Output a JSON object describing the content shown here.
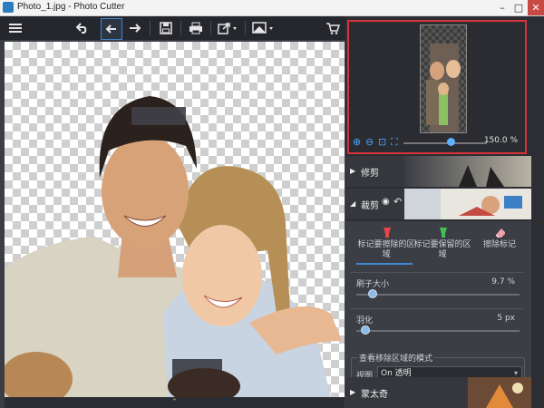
{
  "window": {
    "title": "Photo_1.jpg - Photo Cutter"
  },
  "toolbar": {
    "icons": [
      "menu-icon",
      "undo-icon",
      "redo-back-icon",
      "redo-icon",
      "save-icon",
      "print-icon",
      "export-icon",
      "background-icon",
      "cart-icon"
    ]
  },
  "navigator": {
    "zoom_value": "150.0 %"
  },
  "sections": {
    "crop": {
      "label": "修剪"
    },
    "segment": {
      "label": "裁剪"
    },
    "montage": {
      "label": "蒙太奇"
    }
  },
  "segment_panel": {
    "mark_remove": {
      "line1": "标记要擦除的区",
      "line2": "域"
    },
    "mark_keep": {
      "line1": "标记要保留的区",
      "line2": "域"
    },
    "erase_marks": {
      "label": "擦除标记"
    },
    "brush_size": {
      "label": "刷子大小",
      "value": "9.7 %",
      "level": 0.097
    },
    "feather": {
      "label": "羽化",
      "value": "5 px",
      "level": 0.05
    },
    "view_mode": {
      "legend": "查看移除区域的模式",
      "view_label": "视图",
      "selected": "On 透明"
    }
  },
  "colors": {
    "accent": "#3f88d6",
    "navigator_border": "#d9323a",
    "remove_marker": "#e64545",
    "keep_marker": "#44c056"
  }
}
